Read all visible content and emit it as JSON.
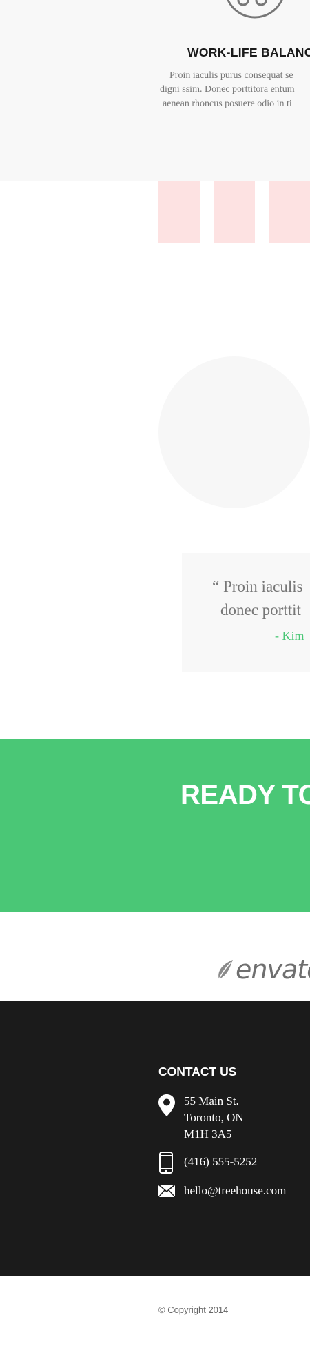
{
  "feature": {
    "title": "WORK-LIFE BALANCE",
    "lines": [
      "Proin iaculis purus consequat se",
      "digni ssim. Donec porttitora entum",
      "aenean rhoncus posuere odio in ti"
    ],
    "icon": "music-note-icon"
  },
  "testimonial": {
    "quote_lines": [
      "“ Proin iaculis",
      "donec porttit"
    ],
    "author": "- Kim"
  },
  "cta": {
    "title": "READY TO"
  },
  "partner": {
    "logo_text": "envato"
  },
  "footer": {
    "contact_title": "CONTACT US",
    "address_lines": [
      "55 Main St.",
      "Toronto, ON",
      "M1H 3A5"
    ],
    "phone": "(416) 555-5252",
    "email": "hello@treehouse.com"
  },
  "copyright": "© Copyright 2014",
  "colors": {
    "accent_green": "#4ac776",
    "tile_pink": "#fde2e2",
    "footer_dark": "#1b1b1b",
    "light_gray": "#f8f8f8"
  }
}
